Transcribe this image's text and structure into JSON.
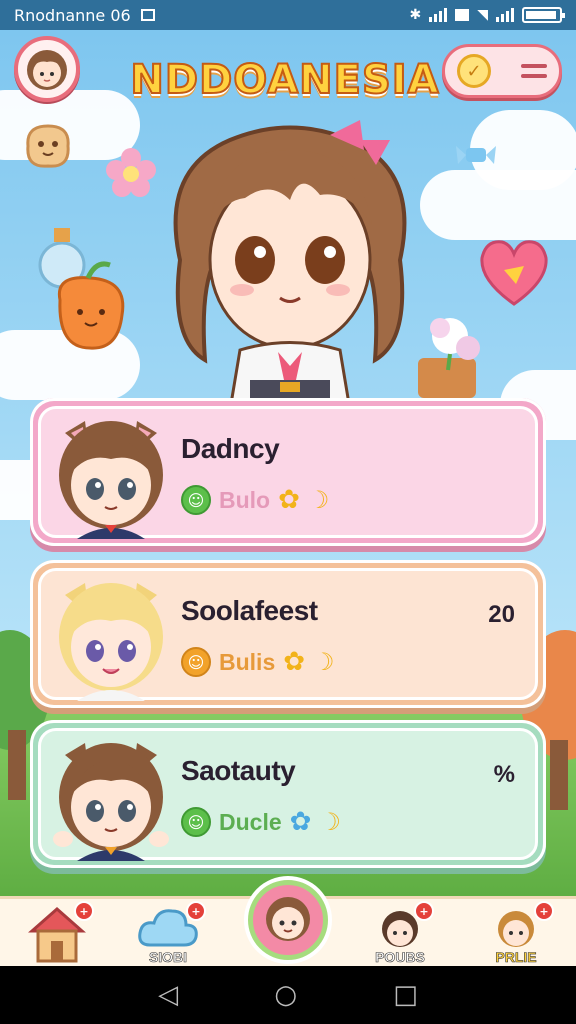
{
  "status_bar": {
    "left_text": "Rnodnanne 06",
    "icons": [
      "image-icon",
      "bluetooth-icon",
      "signal-icon",
      "sim-icon",
      "wifi-icon",
      "signal-icon",
      "battery-icon"
    ]
  },
  "header": {
    "logo_text": "NDDOANESIA",
    "coin_symbol": "✓"
  },
  "characters": [
    {
      "name": "Dadncy",
      "status": "Bulo",
      "status_color": "#5cbf4a",
      "status_text_color": "#e59ab9",
      "badge": "",
      "card_color": "pink"
    },
    {
      "name": "Soolafeest",
      "status": "Bulis",
      "status_color": "#f2a22a",
      "status_text_color": "#e79a3a",
      "badge": "20",
      "card_color": "peach"
    },
    {
      "name": "Saotauty",
      "status": "Ducle",
      "status_color": "#5cbf4a",
      "status_text_color": "#5cae52",
      "badge": "%",
      "card_color": "mint"
    }
  ],
  "bottom_nav": [
    {
      "label": "",
      "icon": "house-icon",
      "badge": "+"
    },
    {
      "label": "SIOBI",
      "icon": "cloud-icon",
      "badge": "+"
    },
    {
      "label": "",
      "icon": "avatar-icon",
      "badge": ""
    },
    {
      "label": "POUBS",
      "icon": "friends-icon",
      "badge": "+"
    },
    {
      "label": "PRLIE",
      "icon": "profile-icon",
      "badge": "+"
    }
  ],
  "system_nav": {
    "back": "◁",
    "home": "○",
    "recents": "□"
  },
  "colors": {
    "accent": "#e86d7c",
    "logo": "#ffd23f",
    "sky": "#8fd0f2"
  }
}
